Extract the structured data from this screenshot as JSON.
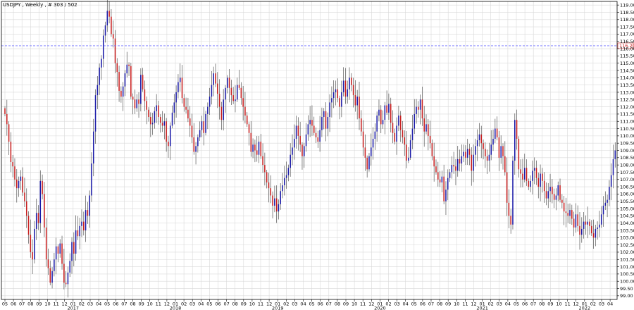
{
  "chart_data": {
    "type": "candlestick",
    "title": "USDJPY , Weekly , # 303 / 502",
    "current_price_label": "116.20",
    "current_price": 116.2,
    "ylim": [
      98.75,
      119.25
    ],
    "y_ticks": [
      "99.00",
      "99.50",
      "100.00",
      "100.50",
      "101.00",
      "101.50",
      "102.00",
      "102.50",
      "103.00",
      "103.50",
      "104.00",
      "104.50",
      "105.00",
      "105.50",
      "106.00",
      "106.50",
      "107.00",
      "107.50",
      "108.00",
      "108.50",
      "109.00",
      "109.50",
      "110.00",
      "110.50",
      "111.00",
      "111.50",
      "112.00",
      "112.50",
      "113.00",
      "113.50",
      "114.00",
      "114.50",
      "115.00",
      "115.50",
      "116.00",
      "116.50",
      "117.00",
      "117.50",
      "118.00",
      "118.50",
      "119.00"
    ],
    "x_month_labels": [
      "05",
      "06",
      "07",
      "08",
      "09",
      "10",
      "11",
      "12",
      "01",
      "02",
      "03",
      "04",
      "05",
      "06",
      "07",
      "08",
      "09",
      "10",
      "11",
      "12",
      "01",
      "02",
      "03",
      "04",
      "05",
      "06",
      "07",
      "08",
      "09",
      "10",
      "11",
      "12",
      "01",
      "02",
      "03",
      "04",
      "05",
      "06",
      "07",
      "08",
      "09",
      "10",
      "11",
      "12",
      "01",
      "02",
      "03",
      "04",
      "05",
      "06",
      "07",
      "08",
      "09",
      "10",
      "11",
      "12",
      "01",
      "02",
      "03",
      "04",
      "05",
      "06",
      "07",
      "08",
      "09",
      "10",
      "11",
      "12",
      "01",
      "02",
      "03",
      "04",
      "05",
      "06"
    ],
    "x_year_labels": [
      {
        "label": "2017",
        "month_index": 8
      },
      {
        "label": "2018",
        "month_index": 20
      },
      {
        "label": "2019",
        "month_index": 32
      },
      {
        "label": "2020",
        "month_index": 44
      },
      {
        "label": "2021",
        "month_index": 56
      },
      {
        "label": "2022",
        "month_index": 68
      }
    ],
    "weeks_per_month": 4.33,
    "candles_start_month_index": 0,
    "colors": {
      "up": "#1a1aa8",
      "down": "#c81e1e",
      "wick": "#555555",
      "grid": "#d9d9d9",
      "price_line": "#7070ff",
      "price_label": "#c81e1e",
      "axis": "#000000"
    },
    "closes": [
      111.5,
      110.8,
      109.6,
      108.2,
      107.9,
      107.0,
      106.4,
      106.9,
      107.2,
      106.1,
      105.5,
      104.5,
      103.2,
      102.0,
      101.5,
      103.6,
      104.7,
      104.0,
      106.9,
      106.0,
      103.7,
      101.5,
      100.9,
      99.9,
      100.7,
      101.5,
      102.4,
      101.9,
      102.6,
      101.2,
      99.9,
      99.8,
      100.6,
      101.4,
      102.7,
      101.9,
      103.5,
      103.1,
      103.8,
      104.1,
      103.5,
      104.9,
      104.5,
      105.9,
      108.1,
      110.3,
      112.8,
      113.5,
      114.7,
      115.3,
      116.9,
      117.6,
      118.6,
      118.2,
      117.0,
      116.7,
      115.0,
      114.4,
      113.1,
      112.7,
      113.4,
      114.3,
      114.9,
      114.8,
      112.7,
      112.5,
      111.9,
      112.5,
      112.2,
      114.2,
      113.2,
      112.4,
      111.8,
      111.3,
      110.8,
      110.9,
      111.7,
      112.1,
      111.3,
      110.9,
      110.7,
      111.0,
      109.6,
      109.3,
      110.7,
      111.6,
      112.3,
      113.0,
      113.7,
      114.0,
      112.6,
      112.0,
      111.8,
      111.2,
      110.7,
      109.9,
      108.9,
      109.3,
      109.9,
      110.4,
      111.0,
      110.2,
      111.5,
      112.0,
      112.7,
      113.5,
      114.3,
      113.6,
      112.9,
      112.0,
      111.1,
      112.5,
      113.3,
      114.0,
      113.3,
      112.8,
      112.4,
      112.5,
      113.5,
      113.3,
      112.6,
      112.0,
      111.4,
      110.8,
      110.2,
      108.9,
      109.4,
      109.0,
      108.7,
      109.6,
      108.6,
      108.0,
      107.5,
      106.8,
      106.4,
      105.9,
      105.2,
      105.7,
      104.8,
      105.3,
      106.2,
      106.6,
      107.1,
      107.3,
      107.8,
      108.7,
      109.2,
      109.8,
      110.7,
      110.0,
      109.4,
      108.6,
      109.3,
      110.1,
      110.8,
      111.1,
      110.7,
      110.2,
      109.9,
      109.6,
      110.4,
      111.3,
      111.7,
      110.5,
      111.3,
      112.3,
      112.6,
      113.0,
      113.2,
      112.6,
      112.0,
      113.0,
      113.8,
      112.7,
      113.2,
      114.0,
      113.5,
      112.8,
      112.1,
      112.7,
      111.2,
      110.3,
      109.2,
      108.5,
      107.7,
      108.6,
      109.2,
      109.8,
      110.3,
      111.4,
      111.8,
      110.8,
      111.1,
      112.1,
      111.6,
      112.2,
      110.9,
      110.2,
      109.6,
      110.7,
      111.4,
      110.4,
      109.9,
      109.4,
      108.3,
      108.5,
      109.7,
      110.5,
      111.5,
      112.0,
      111.8,
      112.5,
      111.2,
      110.3,
      110.8,
      110.0,
      109.5,
      108.6,
      107.9,
      107.5,
      107.0,
      106.8,
      107.2,
      105.5,
      106.3,
      107.1,
      107.5,
      108.0,
      107.9,
      107.6,
      108.4,
      108.1,
      108.6,
      108.9,
      108.5,
      109.1,
      108.7,
      107.6,
      108.7,
      109.3,
      109.7,
      110.1,
      109.5,
      109.1,
      108.6,
      108.3,
      108.7,
      109.4,
      109.8,
      110.5,
      109.9,
      108.5,
      109.3,
      108.6,
      107.5,
      105.4,
      104.5,
      103.9,
      108.3,
      111.1,
      109.8,
      107.7,
      107.4,
      107.0,
      107.8,
      106.9,
      106.5,
      106.9,
      107.6,
      107.8,
      107.1,
      106.5,
      107.4,
      106.9,
      106.2,
      105.7,
      106.2,
      106.5,
      106.0,
      105.6,
      105.9,
      106.6,
      105.6,
      105.4,
      104.8,
      104.7,
      104.5,
      104.9,
      104.3,
      103.7,
      104.6,
      103.8,
      103.2,
      103.6,
      104.1,
      103.9,
      104.1,
      103.8,
      103.3,
      103.0,
      103.6,
      103.7,
      103.9,
      104.6,
      105.2,
      105.4,
      105.6,
      106.5,
      107.3,
      108.4,
      109.0,
      108.8,
      109.6,
      110.7,
      109.7,
      109.0,
      108.8,
      109.3,
      108.2,
      108.9,
      109.5,
      110.0,
      109.8,
      109.2,
      109.8,
      110.3,
      109.6,
      110.2,
      109.7,
      109.9,
      110.4,
      111.1,
      110.0,
      109.7,
      109.9,
      110.3,
      109.9,
      110.7,
      110.3,
      109.5,
      109.9,
      110.5,
      111.3,
      112.2,
      112.9,
      113.8,
      114.3,
      113.9,
      113.5,
      114.0,
      113.3,
      114.6,
      114.9,
      114.0,
      113.5,
      113.7,
      112.9,
      113.4,
      114.1,
      113.7,
      114.5,
      115.1,
      115.6,
      114.5,
      113.7,
      114.0,
      115.2,
      115.6,
      115.9,
      116.2
    ]
  }
}
